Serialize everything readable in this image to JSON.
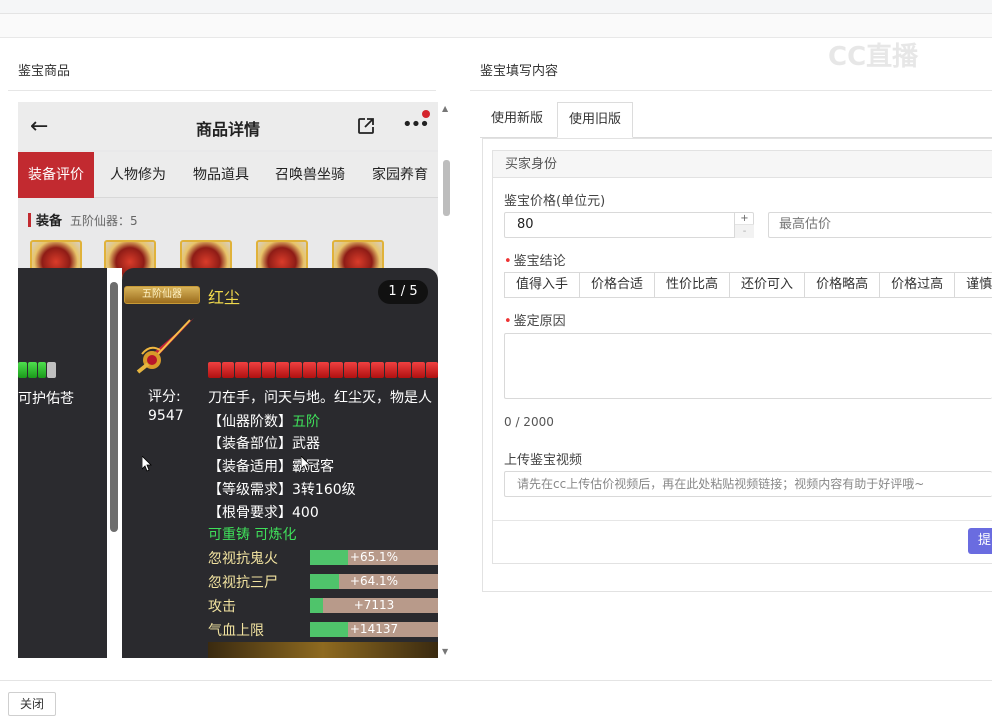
{
  "left": {
    "title": "鉴宝商品"
  },
  "right": {
    "title": "鉴宝填写内容"
  },
  "watermark": "CC直播",
  "phone": {
    "title": "商品详情",
    "tabs": [
      "装备评价",
      "人物修为",
      "物品道具",
      "召唤兽坐骑",
      "家园养育"
    ],
    "equip_label": "装备",
    "equip_sub": "五阶仙器：5",
    "overlay": {
      "badge": "五阶仙器",
      "item_name": "红尘",
      "page": "1 / 5",
      "left_text": "可护佑苍",
      "score_label": "评分:",
      "score_value": "9547",
      "description": "刀在手，问天与地。红尘灭，物是人",
      "attrs": [
        {
          "label": "【仙器阶数】",
          "value": "五阶",
          "green": true
        },
        {
          "label": "【装备部位】",
          "value": "武器",
          "green": false
        },
        {
          "label": "【装备适用】",
          "value": "霸冠客",
          "green": false
        },
        {
          "label": "【等级需求】",
          "value": "3转160级",
          "green": false
        },
        {
          "label": "【根骨要求】",
          "value": "400",
          "green": false
        }
      ],
      "refine": "可重铸 可炼化",
      "stats": [
        {
          "label": "忽视抗鬼火",
          "value": "+65.1%",
          "fill": 0.3
        },
        {
          "label": "忽视抗三尸",
          "value": "+64.1%",
          "fill": 0.23
        },
        {
          "label": "攻击",
          "value": "+7113",
          "fill": 0.1
        },
        {
          "label": "气血上限",
          "value": "+14137",
          "fill": 0.3
        }
      ]
    }
  },
  "form": {
    "tabs": [
      "使用新版",
      "使用旧版"
    ],
    "buyer_identity": "买家身份",
    "price_label": "鉴宝价格(单位元)",
    "price_value": "80",
    "max_placeholder": "最高估价",
    "verdict_label": "鉴宝结论",
    "verdicts": [
      "值得入手",
      "价格合适",
      "性价比高",
      "还价可入",
      "价格略高",
      "价格过高",
      "谨慎购"
    ],
    "reason_label": "鉴定原因",
    "counter": "0 / 2000",
    "video_label": "上传鉴宝视频",
    "video_placeholder": "请先在cc上传估价视频后，再在此处粘贴视频链接；视频内容有助于好评哦~",
    "submit": "提"
  },
  "close": "关闭"
}
